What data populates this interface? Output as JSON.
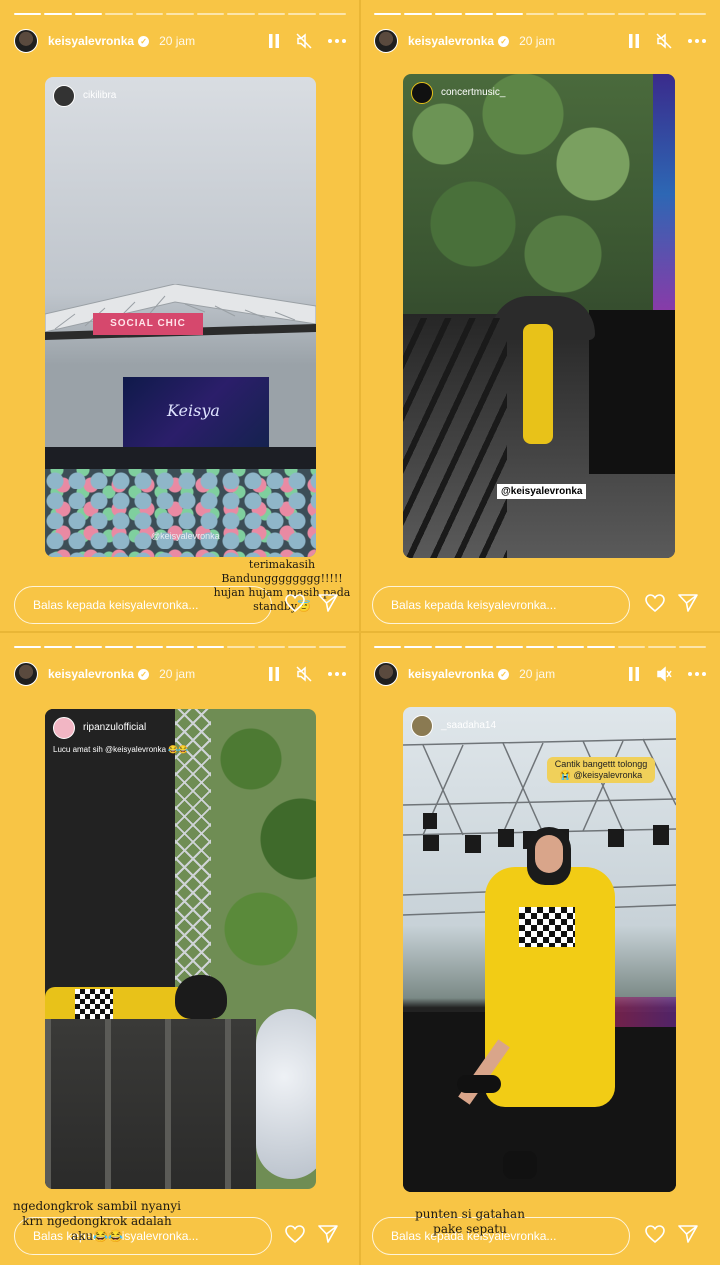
{
  "stories": [
    {
      "username": "keisyalevronka",
      "time": "20 jam",
      "progress_done": 3,
      "progress_total": 11,
      "reposter": "cikilibra",
      "media_sign": "Keisya",
      "media_banner": "SOCIAL CHIC",
      "media_tag": "@keisyalevronka",
      "caption": "terimakasih Bandungggggggg!!!!! hujan hujam masih pada standby😇",
      "reply_placeholder": "Balas kepada keisyalevronka..."
    },
    {
      "username": "keisyalevronka",
      "time": "20 jam",
      "progress_done": 5,
      "progress_total": 11,
      "reposter": "concertmusic_",
      "media_tag": "@keisyalevronka",
      "caption": "",
      "reply_placeholder": "Balas kepada keisyalevronka..."
    },
    {
      "username": "keisyalevronka",
      "time": "20 jam",
      "progress_done": 7,
      "progress_total": 11,
      "reposter": "ripanzulofficial",
      "media_comment": "Lucu amat sih @keisyalevronka 😂😂",
      "caption": "ngedongkrok sambil nyanyi krn ngedongkrok adalah aku😂😂",
      "reply_placeholder": "Balas kepada keisyalevronka..."
    },
    {
      "username": "keisyalevronka",
      "time": "20 jam",
      "progress_done": 8,
      "progress_total": 11,
      "reposter": "_saadaha14",
      "media_comment": "Cantik bangettt tolongg 😭 @keisyalevronka",
      "caption": "punten si gatahan pake sepatu",
      "reply_placeholder": "Balas kepada keisyalevronka..."
    }
  ],
  "colors": {
    "background": "#f8c545",
    "foreground": "#ffffff"
  },
  "icons": [
    "pause-icon",
    "mute-icon",
    "more-icon",
    "heart-icon",
    "send-icon",
    "verified-icon"
  ]
}
